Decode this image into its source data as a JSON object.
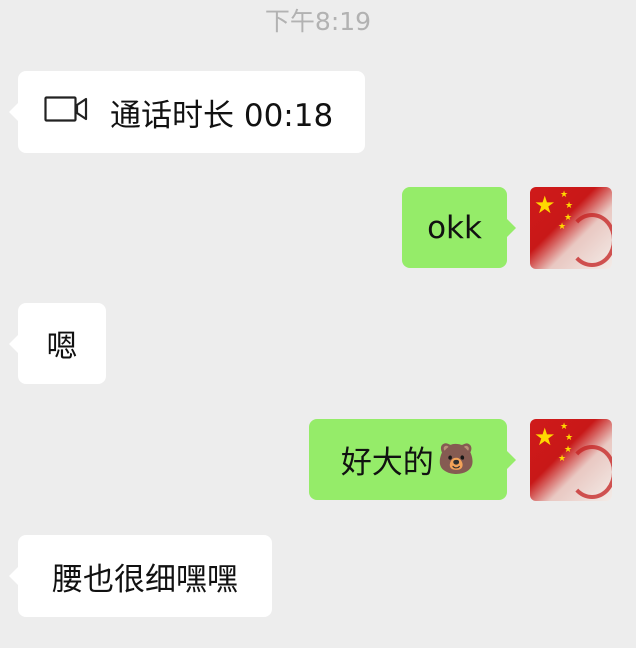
{
  "timestamp": "下午8:19",
  "messages": [
    {
      "label": "通话时长 00:18",
      "icon": "video-camera-icon"
    },
    {
      "label": "okk"
    },
    {
      "label": "嗯"
    },
    {
      "label": "好大的",
      "emoji": "🐻"
    },
    {
      "label": "腰也很细嘿嘿"
    }
  ],
  "avatar": {
    "icon": "china-flag-avatar",
    "colors": [
      "#d01a1a",
      "#ffd800"
    ]
  },
  "colors": {
    "background": "#ededed",
    "incoming": "#ffffff",
    "outgoing": "#95ec69",
    "timestamp": "#b2b2b2"
  }
}
